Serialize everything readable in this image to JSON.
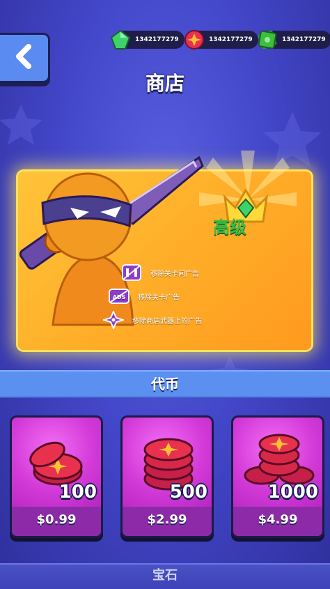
{
  "header": {
    "title": "商店",
    "currencies": [
      {
        "name": "gem",
        "value": "1342177279",
        "color": "#3ed26b"
      },
      {
        "name": "shuriken-coin",
        "value": "1342177279",
        "color": "#e8314f"
      },
      {
        "name": "cash",
        "value": "1342177279",
        "color": "#3cbf3c"
      }
    ]
  },
  "premium": {
    "badge_label": "高级",
    "perks": [
      {
        "icon": "no-video-ads-icon",
        "label": "移除关卡间广告"
      },
      {
        "icon": "no-ads-icon",
        "label": "移除关卡广告"
      },
      {
        "icon": "shuriken-icon",
        "label": "移除商店武器上的广告"
      }
    ],
    "ads_label": "ADS"
  },
  "coins_section": {
    "title": "代币",
    "packs": [
      {
        "amount": "100",
        "price": "$0.99"
      },
      {
        "amount": "500",
        "price": "$2.99"
      },
      {
        "amount": "1000",
        "price": "$4.99"
      }
    ]
  },
  "footer": {
    "next_section_label": "宝石"
  },
  "colors": {
    "accent": "#5b8ff0",
    "premium": "#ffb02a",
    "card": "#d33ad8",
    "price_bar": "#8c2aa8"
  }
}
